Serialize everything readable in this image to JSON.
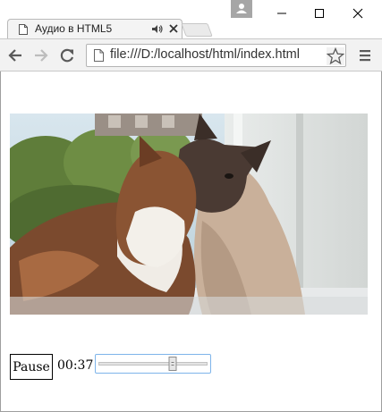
{
  "tab": {
    "title": "Аудио в HTML5",
    "icons": [
      "document-icon",
      "audio-playing-icon",
      "close-icon"
    ]
  },
  "toolbar": {
    "url": "file:///D:/localhost/html/index.html",
    "icons": [
      "back-icon",
      "forward-icon",
      "reload-icon",
      "page-icon",
      "star-icon",
      "menu-icon"
    ]
  },
  "window": {
    "buttons": [
      "profile-icon",
      "minimize-icon",
      "maximize-icon",
      "close-icon"
    ]
  },
  "player": {
    "button_label": "Pause",
    "time": "00:37",
    "progress": 0.7
  },
  "colors": {
    "focus_border": "#7eb4ea",
    "tab_background": "#f4f4f4",
    "toolbar_background": "#f2f2f2"
  }
}
